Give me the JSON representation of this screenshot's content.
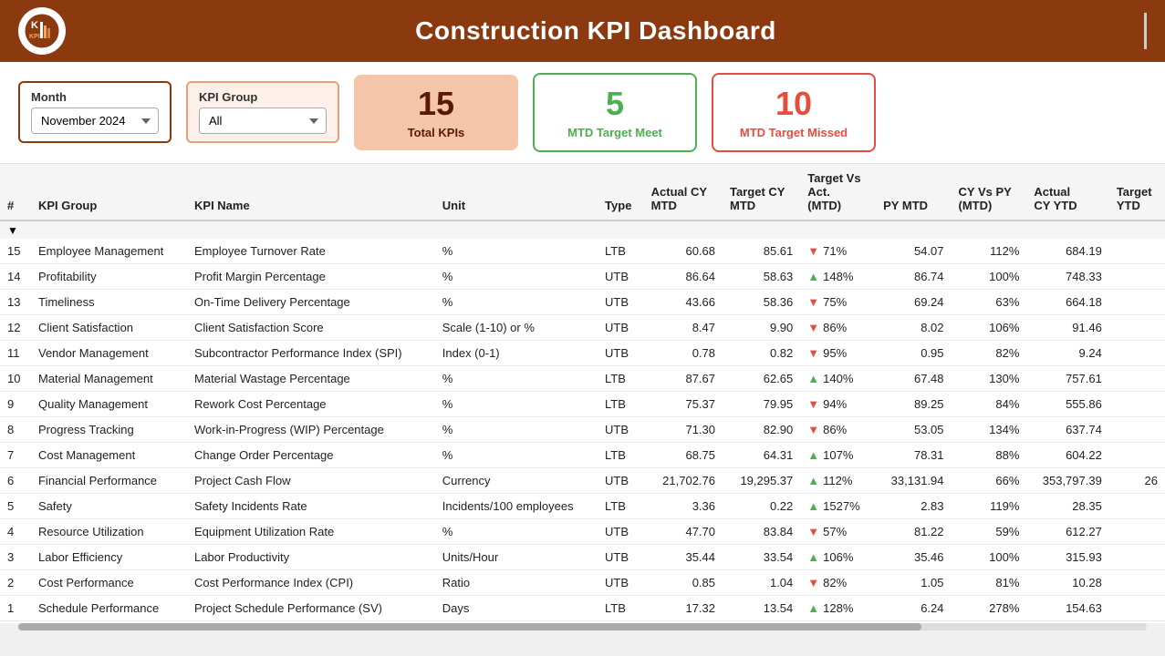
{
  "header": {
    "title": "Construction KPI Dashboard",
    "logo_text": "K"
  },
  "filters": {
    "month_label": "Month",
    "month_value": "November 2024",
    "kpi_group_label": "KPI Group",
    "kpi_group_value": "All"
  },
  "summary": {
    "total_label": "Total KPIs",
    "total_value": "15",
    "meet_label": "MTD Target Meet",
    "meet_value": "5",
    "missed_label": "MTD Target Missed",
    "missed_value": "10"
  },
  "table": {
    "columns": [
      "#",
      "KPI Group",
      "KPI Name",
      "Unit",
      "Type",
      "Actual CY MTD",
      "Target CY MTD",
      "Target Vs Act. (MTD)",
      "PY MTD",
      "CY Vs PY (MTD)",
      "Actual CY YTD",
      "Target YTD"
    ],
    "rows": [
      {
        "num": "15",
        "group": "Employee Management",
        "name": "Employee Turnover Rate",
        "unit": "%",
        "type": "LTB",
        "actual_cy_mtd": "60.68",
        "target_cy_mtd": "85.61",
        "vs_dir": "down",
        "vs_pct": "71%",
        "py_mtd": "54.07",
        "cy_vs_py": "112%",
        "actual_cy_ytd": "684.19",
        "target_ytd": ""
      },
      {
        "num": "14",
        "group": "Profitability",
        "name": "Profit Margin Percentage",
        "unit": "%",
        "type": "UTB",
        "actual_cy_mtd": "86.64",
        "target_cy_mtd": "58.63",
        "vs_dir": "up",
        "vs_pct": "148%",
        "py_mtd": "86.74",
        "cy_vs_py": "100%",
        "actual_cy_ytd": "748.33",
        "target_ytd": ""
      },
      {
        "num": "13",
        "group": "Timeliness",
        "name": "On-Time Delivery Percentage",
        "unit": "%",
        "type": "UTB",
        "actual_cy_mtd": "43.66",
        "target_cy_mtd": "58.36",
        "vs_dir": "down",
        "vs_pct": "75%",
        "py_mtd": "69.24",
        "cy_vs_py": "63%",
        "actual_cy_ytd": "664.18",
        "target_ytd": ""
      },
      {
        "num": "12",
        "group": "Client Satisfaction",
        "name": "Client Satisfaction Score",
        "unit": "Scale (1-10) or %",
        "type": "UTB",
        "actual_cy_mtd": "8.47",
        "target_cy_mtd": "9.90",
        "vs_dir": "down",
        "vs_pct": "86%",
        "py_mtd": "8.02",
        "cy_vs_py": "106%",
        "actual_cy_ytd": "91.46",
        "target_ytd": ""
      },
      {
        "num": "11",
        "group": "Vendor Management",
        "name": "Subcontractor Performance Index (SPI)",
        "unit": "Index (0-1)",
        "type": "UTB",
        "actual_cy_mtd": "0.78",
        "target_cy_mtd": "0.82",
        "vs_dir": "down",
        "vs_pct": "95%",
        "py_mtd": "0.95",
        "cy_vs_py": "82%",
        "actual_cy_ytd": "9.24",
        "target_ytd": ""
      },
      {
        "num": "10",
        "group": "Material Management",
        "name": "Material Wastage Percentage",
        "unit": "%",
        "type": "LTB",
        "actual_cy_mtd": "87.67",
        "target_cy_mtd": "62.65",
        "vs_dir": "up",
        "vs_pct": "140%",
        "py_mtd": "67.48",
        "cy_vs_py": "130%",
        "actual_cy_ytd": "757.61",
        "target_ytd": ""
      },
      {
        "num": "9",
        "group": "Quality Management",
        "name": "Rework Cost Percentage",
        "unit": "%",
        "type": "LTB",
        "actual_cy_mtd": "75.37",
        "target_cy_mtd": "79.95",
        "vs_dir": "down",
        "vs_pct": "94%",
        "py_mtd": "89.25",
        "cy_vs_py": "84%",
        "actual_cy_ytd": "555.86",
        "target_ytd": ""
      },
      {
        "num": "8",
        "group": "Progress Tracking",
        "name": "Work-in-Progress (WIP) Percentage",
        "unit": "%",
        "type": "UTB",
        "actual_cy_mtd": "71.30",
        "target_cy_mtd": "82.90",
        "vs_dir": "down",
        "vs_pct": "86%",
        "py_mtd": "53.05",
        "cy_vs_py": "134%",
        "actual_cy_ytd": "637.74",
        "target_ytd": ""
      },
      {
        "num": "7",
        "group": "Cost Management",
        "name": "Change Order Percentage",
        "unit": "%",
        "type": "LTB",
        "actual_cy_mtd": "68.75",
        "target_cy_mtd": "64.31",
        "vs_dir": "up",
        "vs_pct": "107%",
        "py_mtd": "78.31",
        "cy_vs_py": "88%",
        "actual_cy_ytd": "604.22",
        "target_ytd": ""
      },
      {
        "num": "6",
        "group": "Financial Performance",
        "name": "Project Cash Flow",
        "unit": "Currency",
        "type": "UTB",
        "actual_cy_mtd": "21,702.76",
        "target_cy_mtd": "19,295.37",
        "vs_dir": "up",
        "vs_pct": "112%",
        "py_mtd": "33,131.94",
        "cy_vs_py": "66%",
        "actual_cy_ytd": "353,797.39",
        "target_ytd": "26"
      },
      {
        "num": "5",
        "group": "Safety",
        "name": "Safety Incidents Rate",
        "unit": "Incidents/100 employees",
        "type": "LTB",
        "actual_cy_mtd": "3.36",
        "target_cy_mtd": "0.22",
        "vs_dir": "up",
        "vs_pct": "1527%",
        "py_mtd": "2.83",
        "cy_vs_py": "119%",
        "actual_cy_ytd": "28.35",
        "target_ytd": ""
      },
      {
        "num": "4",
        "group": "Resource Utilization",
        "name": "Equipment Utilization Rate",
        "unit": "%",
        "type": "UTB",
        "actual_cy_mtd": "47.70",
        "target_cy_mtd": "83.84",
        "vs_dir": "down",
        "vs_pct": "57%",
        "py_mtd": "81.22",
        "cy_vs_py": "59%",
        "actual_cy_ytd": "612.27",
        "target_ytd": ""
      },
      {
        "num": "3",
        "group": "Labor Efficiency",
        "name": "Labor Productivity",
        "unit": "Units/Hour",
        "type": "UTB",
        "actual_cy_mtd": "35.44",
        "target_cy_mtd": "33.54",
        "vs_dir": "up",
        "vs_pct": "106%",
        "py_mtd": "35.46",
        "cy_vs_py": "100%",
        "actual_cy_ytd": "315.93",
        "target_ytd": ""
      },
      {
        "num": "2",
        "group": "Cost Performance",
        "name": "Cost Performance Index (CPI)",
        "unit": "Ratio",
        "type": "UTB",
        "actual_cy_mtd": "0.85",
        "target_cy_mtd": "1.04",
        "vs_dir": "down",
        "vs_pct": "82%",
        "py_mtd": "1.05",
        "cy_vs_py": "81%",
        "actual_cy_ytd": "10.28",
        "target_ytd": ""
      },
      {
        "num": "1",
        "group": "Schedule Performance",
        "name": "Project Schedule Performance (SV)",
        "unit": "Days",
        "type": "LTB",
        "actual_cy_mtd": "17.32",
        "target_cy_mtd": "13.54",
        "vs_dir": "up",
        "vs_pct": "128%",
        "py_mtd": "6.24",
        "cy_vs_py": "278%",
        "actual_cy_ytd": "154.63",
        "target_ytd": ""
      }
    ]
  }
}
